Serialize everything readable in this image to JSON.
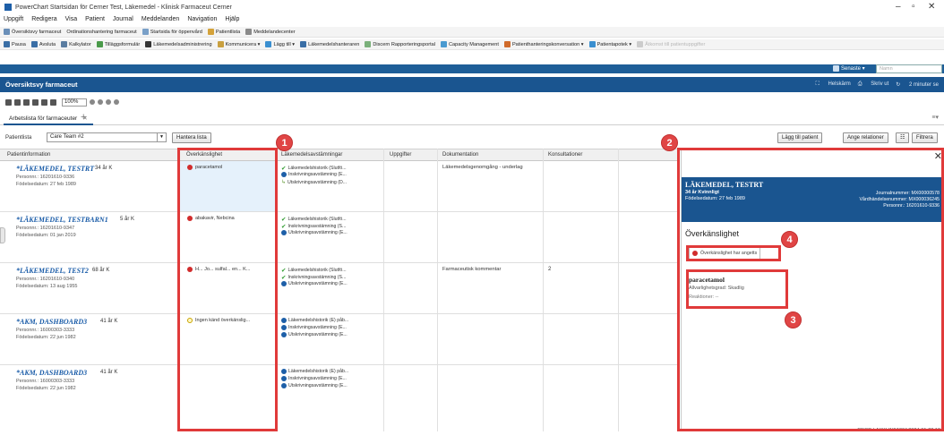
{
  "window": {
    "title": "PowerChart Startsidan för Cerner Test, Läkemedel - Klinisk Farmaceut Cerner"
  },
  "menu": [
    "Uppgift",
    "Redigera",
    "Visa",
    "Patient",
    "Journal",
    "Meddelanden",
    "Navigation",
    "Hjälp"
  ],
  "toolbar1": [
    {
      "label": "Översiktsvy farmaceut",
      "icon": "grid-icon"
    },
    {
      "label": "Ordinationshantering farmaceut",
      "icon": "none"
    },
    {
      "label": "Startsida för öppenvård",
      "icon": "home-icon"
    },
    {
      "label": "Patientlista",
      "icon": "person-icon"
    },
    {
      "label": "Meddelandecenter",
      "icon": "mail-icon"
    }
  ],
  "toolbar2": [
    {
      "label": "Pausa",
      "icon": "pause-icon"
    },
    {
      "label": "Avsluta",
      "icon": "exit-icon"
    },
    {
      "label": "Kalkylator",
      "icon": "calculator-icon"
    },
    {
      "label": "Tilläggsformulär",
      "icon": "form-icon"
    },
    {
      "label": "Läkemedelsadministrering",
      "icon": "barcode-icon"
    },
    {
      "label": "Kommunicera ▾",
      "icon": "communicate-icon"
    },
    {
      "label": "Lägg till ▾",
      "icon": "plus-icon"
    },
    {
      "label": "Läkemedelshanteraren",
      "icon": "medication-icon"
    },
    {
      "label": "Discern Rapporteringsportal",
      "icon": "report-icon"
    },
    {
      "label": "Capacity Management",
      "icon": "capacity-icon"
    },
    {
      "label": "Patienthanteringskonversation ▾",
      "icon": "conversation-icon"
    },
    {
      "label": "Patientapotek ▾",
      "icon": "pharmacy-icon"
    },
    {
      "label": "Åtkomst till patientuppgifter",
      "icon": "access-icon",
      "disabled": true
    }
  ],
  "search": {
    "recent_label": "Senaste ▾",
    "name_placeholder": "Namn"
  },
  "bluebar": {
    "title": "Översiktsvy farmaceut",
    "fullscreen": "Helskärm",
    "print": "Skriv ut",
    "refresh": "2 minuter se"
  },
  "zoom": "100%",
  "tab": {
    "label": "Arbetslista för farmaceuter",
    "close": "✕",
    "add": "+"
  },
  "filter": {
    "label": "Patientlista",
    "value": "Care Team #2",
    "manage": "Hantera lista",
    "add_patient": "Lägg till patient",
    "relations": "Ange relationer",
    "filter": "Filtrera"
  },
  "grid": {
    "headers": {
      "patient": "Patientinformation",
      "allergy": "Överkänslighet",
      "reconciliation": "Läkemedelsavstämningar",
      "tasks": "Uppgifter",
      "documentation": "Dokumentation",
      "consultations": "Konsultationer"
    },
    "rows": [
      {
        "name": "*LÄKEMEDEL, TESTRT",
        "age": "34 år  K",
        "pnr": "Personnr.: 16201610-9336",
        "dob": "Födelsedatum: 27 feb 1989",
        "allergy": "paracetamol",
        "allergy_type": "red",
        "med1": "Läkemedelshistorik (Slutfö...",
        "med2": "Inskrivningsavstämning (E...",
        "med3": "Utskrivningsavstämning (D...",
        "documentation": "Läkemedelsgenomgång - underlag",
        "consultations": ""
      },
      {
        "name": "*LÄKEMEDEL, TESTBARN1",
        "age": "5 år  K",
        "pnr": "Personnr.: 16201610-9347",
        "dob": "Födelsedatum: 01 jan 2019",
        "allergy": "abakavir, Nebcina",
        "allergy_type": "red",
        "med1": "Läkemedelshistorik (Slutfö...",
        "med2": "Inskrivningsavstämning (S...",
        "med3": "Utskrivningsavstämning (E...",
        "documentation": "",
        "consultations": ""
      },
      {
        "name": "*LÄKEMEDEL, TEST2",
        "age": "68 år  K",
        "pnr": "Personnr.: 16201610-9340",
        "dob": "Födelsedatum: 13 aug 1955",
        "allergy": "H... Jo... sulfal... en... K...",
        "allergy_type": "red",
        "med1": "Läkemedelshistorik (Slutfö...",
        "med2": "Inskrivningsavstämning (S...",
        "med3": "Utskrivningsavstämning (E...",
        "documentation": "Farmaceutisk kommentar",
        "consultations": "2"
      },
      {
        "name": "*AKM, DASHBOARD3",
        "age": "41 år  K",
        "pnr": "Personnr.: 16000303-3333",
        "dob": "Födelsedatum: 22 jun 1982",
        "allergy": "Ingen känd överkänslig...",
        "allergy_type": "yellow",
        "med1": "Läkemedelshistorik (E) påb...",
        "med2": "Inskrivningsavstämning (E...",
        "med3": "Utskrivningsavstämning (E...",
        "documentation": "",
        "consultations": ""
      },
      {
        "name": "*AKM, DASHBOARD3",
        "age": "41 år  K",
        "pnr": "Personnr.: 16000303-3333",
        "dob": "Födelsedatum: 22 jun 1982",
        "allergy": "",
        "allergy_type": "none",
        "med1": "Läkemedelshistorik (E) påb...",
        "med2": "Inskrivningsavstämning (E...",
        "med3": "Utskrivningsavstämning (E...",
        "documentation": "",
        "consultations": ""
      }
    ]
  },
  "panel": {
    "close": "✕",
    "name": "LÄKEMEDEL, TESTRT",
    "line1": "34 år  Kvinnligt",
    "line2": "Födelsedatum: 27 feb 1989",
    "journal": "Journalnummer: MX00000578",
    "episode": "Vårdhändelsenummer: MX000036245",
    "pnr": "Personnr.: 16201610-9336",
    "section_title": "Överkänslighet",
    "badge": "Överkänslighet har angetts",
    "allergy_name": "paracetamol",
    "severity": "Allvarlighetsgrad: Skadlig",
    "reactions": "Reaktioner: --"
  },
  "status": "PROD  LAKKLINFARM  2024-01-22  13",
  "markers": [
    "1",
    "2",
    "3",
    "4"
  ],
  "colors": {
    "brand_blue": "#1a5590",
    "highlight_red": "#e03a3a",
    "link_blue": "#1a5ca8"
  }
}
